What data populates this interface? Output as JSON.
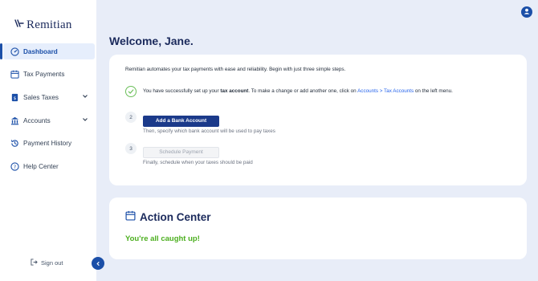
{
  "brand": {
    "name": "Remitian"
  },
  "sidebar": {
    "items": [
      {
        "label": "Dashboard",
        "icon": "dashboard-icon",
        "active": true
      },
      {
        "label": "Tax Payments",
        "icon": "calendar-icon"
      },
      {
        "label": "Sales Taxes",
        "icon": "receipt-icon",
        "expandable": true
      },
      {
        "label": "Accounts",
        "icon": "bank-icon",
        "expandable": true
      },
      {
        "label": "Payment History",
        "icon": "history-icon"
      },
      {
        "label": "Help Center",
        "icon": "help-icon"
      }
    ],
    "signout_label": "Sign out"
  },
  "header": {
    "welcome": "Welcome, Jane."
  },
  "setup": {
    "intro": "Remitian automates your tax payments with ease and reliability. Begin with just three simple steps.",
    "step1": {
      "text_before": "You have successfully set up your ",
      "text_bold": "tax account",
      "text_middle": ". To make a change or add another one, click on ",
      "link": "Accounts > Tax Accounts",
      "text_after": " on the left menu."
    },
    "step2": {
      "number": "2",
      "button": "Add a Bank Account",
      "subtext": "Then, specify which bank account will be used to pay taxes"
    },
    "step3": {
      "number": "3",
      "button": "Schedule Payment",
      "subtext": "Finally, schedule when your taxes should be paid"
    }
  },
  "action_center": {
    "title": "Action Center",
    "message": "You're all caught up!"
  },
  "colors": {
    "accent": "#1b4fa8",
    "brand_dark": "#1b2a5c",
    "success": "#4caf1f",
    "background": "#e8edf8"
  }
}
